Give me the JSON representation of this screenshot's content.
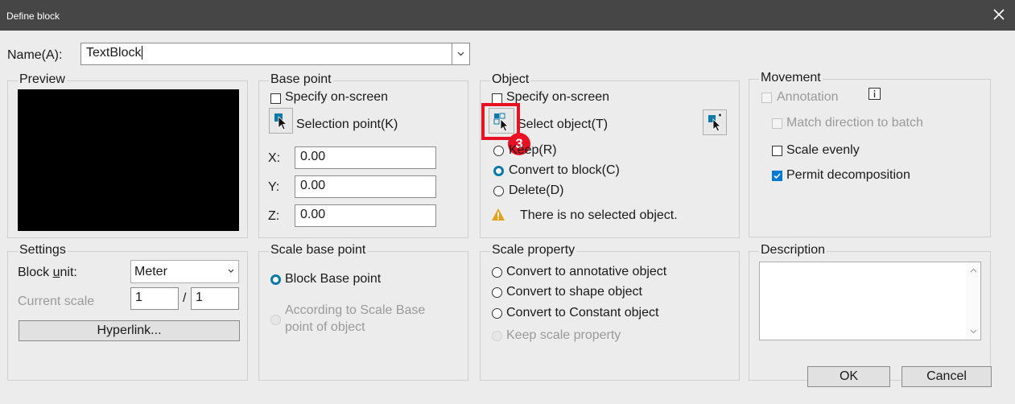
{
  "window": {
    "title": "Define block"
  },
  "name_field": {
    "label": "Name(A):",
    "value": "TextBlock"
  },
  "preview": {
    "legend": "Preview"
  },
  "base_point": {
    "legend": "Base point",
    "specify_label": "Specify on-screen",
    "selection_label": "Selection point(K)",
    "x_label": "X:",
    "x_value": "0.00",
    "y_label": "Y:",
    "y_value": "0.00",
    "z_label": "Z:",
    "z_value": "0.00"
  },
  "object": {
    "legend": "Object",
    "specify_label": "Specify on-screen",
    "select_label": "Select object(T)",
    "keep_label": "Keep(R)",
    "convert_label": "Convert to block(C)",
    "delete_label": "Delete(D)",
    "warning": "There is no selected object.",
    "marker": "3"
  },
  "movement": {
    "legend": "Movement",
    "annotation_label": "Annotation",
    "match_label": "Match direction to batch",
    "scale_evenly_label": "Scale evenly",
    "permit_label": "Permit decomposition"
  },
  "settings": {
    "legend": "Settings",
    "block_unit_prefix": "Block ",
    "block_unit_key": "u",
    "block_unit_suffix": "nit:",
    "unit_value": "Meter",
    "current_scale_label": "Current scale",
    "scale_num": "1",
    "scale_sep": "/",
    "scale_den": "1",
    "hyperlink_label": "Hyperlink..."
  },
  "scale_base_point": {
    "legend": "Scale base point",
    "block_base_label": "Block Base point",
    "according_line1": "According to Scale Base",
    "according_line2": "point of object"
  },
  "scale_property": {
    "legend": "Scale property",
    "annotative_label": "Convert to annotative object",
    "shape_label": "Convert to shape object",
    "constant_label": "Convert to Constant object",
    "keep_label": "Keep scale property"
  },
  "description": {
    "legend": "Description",
    "value": ""
  },
  "buttons": {
    "ok": "OK",
    "cancel": "Cancel"
  },
  "colors": {
    "titlebar": "#464646",
    "accent": "#0a7aa8",
    "highlight": "#e81123",
    "checked": "#0078d7"
  }
}
